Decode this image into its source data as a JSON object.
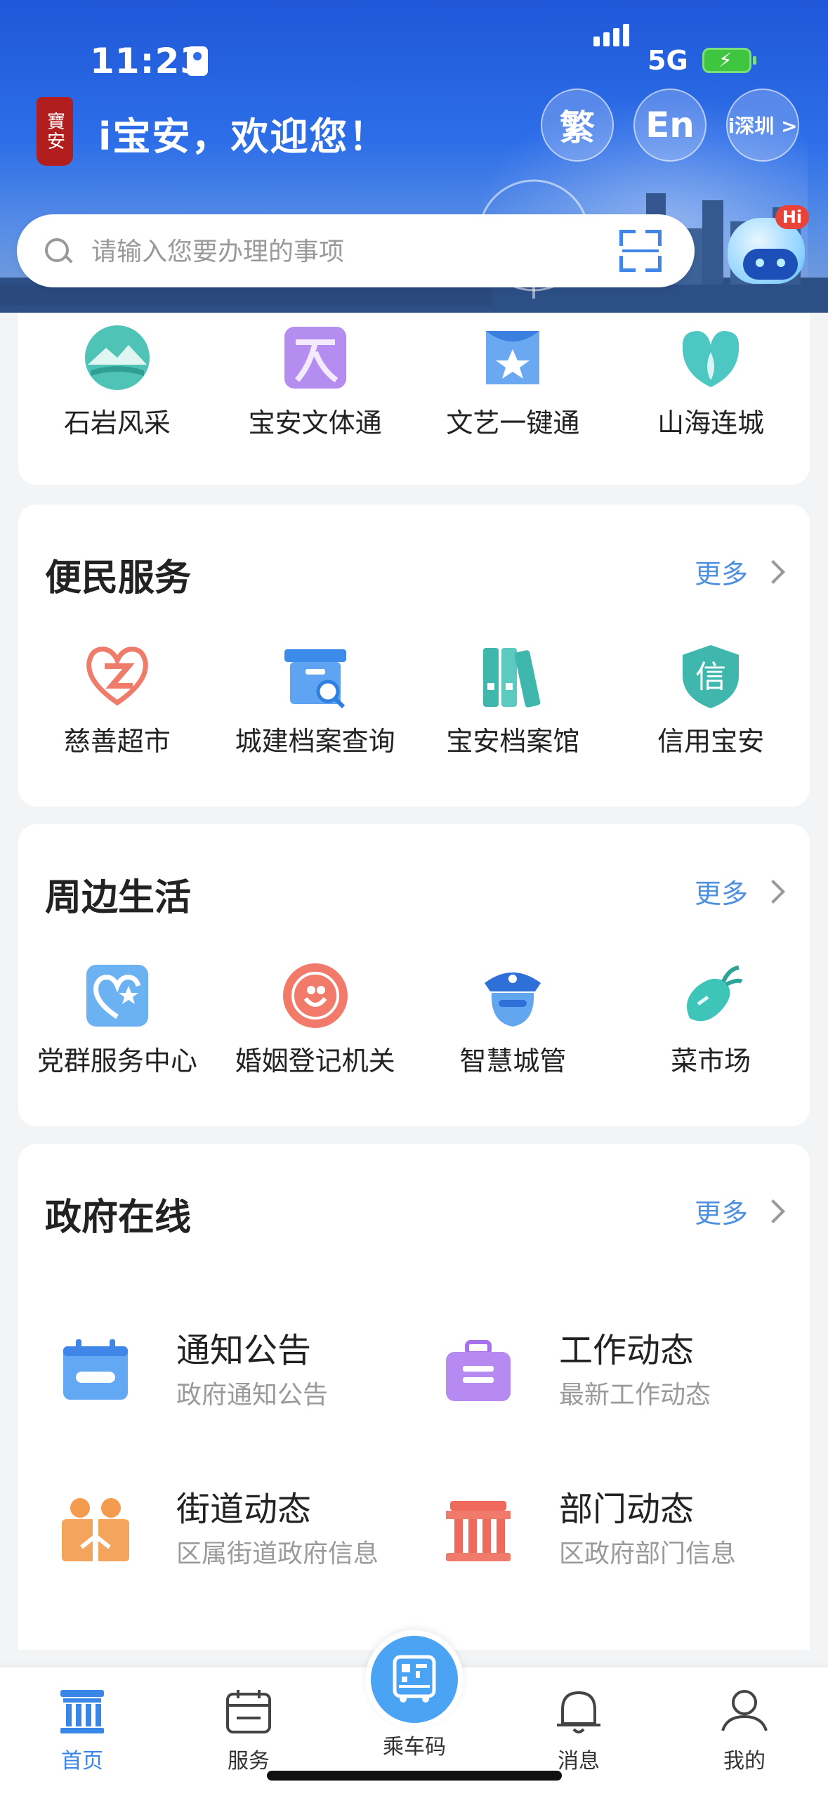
{
  "status_bar": {
    "time": "11:23",
    "network": "5G"
  },
  "header": {
    "welcome": "i宝安，欢迎您！",
    "btn_traditional": "繁",
    "btn_english": "En",
    "btn_city": "i深圳 >"
  },
  "search": {
    "placeholder": "请输入您要办理的事项"
  },
  "assistant": {
    "badge": "Hi"
  },
  "top_grid": {
    "items": [
      {
        "label": "石岩风采",
        "icon": "mountain-lake-icon"
      },
      {
        "label": "宝安文体通",
        "icon": "culture-sports-icon"
      },
      {
        "label": "文艺一键通",
        "icon": "stage-star-icon"
      },
      {
        "label": "山海连城",
        "icon": "leaf-drop-icon"
      }
    ]
  },
  "convenience": {
    "title": "便民服务",
    "more": "更多",
    "items": [
      {
        "label": "慈善超市",
        "icon": "charity-heart-icon"
      },
      {
        "label": "城建档案查询",
        "icon": "archive-search-icon"
      },
      {
        "label": "宝安档案馆",
        "icon": "binders-icon"
      },
      {
        "label": "信用宝安",
        "icon": "credit-shield-icon"
      }
    ]
  },
  "nearby": {
    "title": "周边生活",
    "more": "更多",
    "items": [
      {
        "label": "党群服务中心",
        "icon": "heart-star-icon"
      },
      {
        "label": "婚姻登记机关",
        "icon": "marriage-icon"
      },
      {
        "label": "智慧城管",
        "icon": "officer-icon"
      },
      {
        "label": "菜市场",
        "icon": "radish-icon"
      }
    ]
  },
  "government": {
    "title": "政府在线",
    "more": "更多",
    "items": [
      {
        "title": "通知公告",
        "subtitle": "政府通知公告",
        "icon": "calendar-notice-icon"
      },
      {
        "title": "工作动态",
        "subtitle": "最新工作动态",
        "icon": "briefcase-icon"
      },
      {
        "title": "街道动态",
        "subtitle": "区属街道政府信息",
        "icon": "people-icon"
      },
      {
        "title": "部门动态",
        "subtitle": "区政府部门信息",
        "icon": "government-building-icon"
      }
    ]
  },
  "tabbar": {
    "items": [
      {
        "label": "首页",
        "icon": "home-building-icon",
        "active": true
      },
      {
        "label": "服务",
        "icon": "calendar-service-icon"
      },
      {
        "label": "乘车码",
        "icon": "bus-qr-icon"
      },
      {
        "label": "消息",
        "icon": "bell-icon"
      },
      {
        "label": "我的",
        "icon": "user-icon"
      }
    ]
  },
  "colors": {
    "accent": "#3a86e6",
    "link": "#4d8fe0",
    "hero_top": "#1f57d8"
  }
}
